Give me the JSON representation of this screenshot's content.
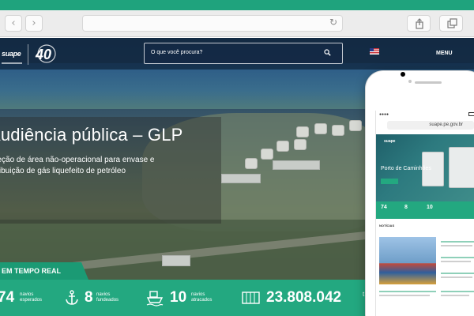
{
  "browser": {
    "back_icon": "chevron-left-icon",
    "forward_icon": "chevron-right-icon",
    "back_glyph": "‹",
    "forward_glyph": "›",
    "reload_glyph": "↻",
    "accent_color": "#1fa37d"
  },
  "site": {
    "logo_text": "suape",
    "anniversary_logo": "40",
    "search_placeholder": "O que você procura?",
    "menu_label": "MENU"
  },
  "hero": {
    "headline": "Audiência pública – GLP",
    "subline_1": "Seleção de área não-operacional para envase e",
    "subline_2": "distribuição de gás liquefeito de petróleo",
    "realtime_label": "EM TEMPO REAL"
  },
  "stats": [
    {
      "value": "74",
      "label_1": "navios",
      "label_2": "esperados",
      "icon": "ship-icon"
    },
    {
      "value": "8",
      "label_1": "navios",
      "label_2": "fundeados",
      "icon": "anchor-icon"
    },
    {
      "value": "10",
      "label_1": "navios",
      "label_2": "atracados",
      "icon": "ship-docked-icon"
    },
    {
      "value": "23.808.042",
      "label_1": "t",
      "label_2": "",
      "icon": "container-icon"
    }
  ],
  "phone": {
    "url": "suape.pe.gov.br",
    "hero_title": "Porto de Caminhões",
    "section_title": "NOTÍCIAS",
    "stats": [
      "74",
      "8",
      "10"
    ]
  }
}
